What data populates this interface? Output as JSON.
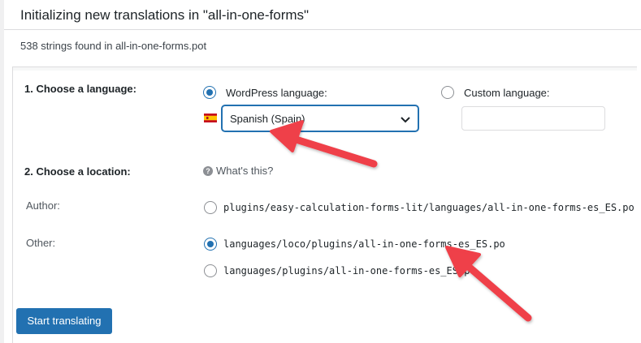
{
  "header": {
    "title": "Initializing new translations in \"all-in-one-forms\"",
    "summary": "538 strings found in all-in-one-forms.pot"
  },
  "language": {
    "section_label": "1. Choose a language:",
    "wordpress_option_label": "WordPress language:",
    "wordpress_selected": true,
    "selected_value": "Spanish (Spain)",
    "flag_icon": "spain-flag-icon",
    "custom_option_label": "Custom language:",
    "custom_selected": false,
    "custom_value": ""
  },
  "location": {
    "section_label": "2. Choose a location:",
    "help_link": "What's this?",
    "author_label": "Author:",
    "author_path": "plugins/easy-calculation-forms-lit/languages/all-in-one-forms-es_ES.po",
    "other_label": "Other:",
    "other_options": [
      {
        "path": "languages/loco/plugins/all-in-one-forms-es_ES.po",
        "selected": true
      },
      {
        "path": "languages/plugins/all-in-one-forms-es_ES.po",
        "selected": false
      }
    ]
  },
  "actions": {
    "start_label": "Start translating"
  },
  "colors": {
    "accent": "#2271b1",
    "annotation_arrow": "#ef3f4a"
  }
}
